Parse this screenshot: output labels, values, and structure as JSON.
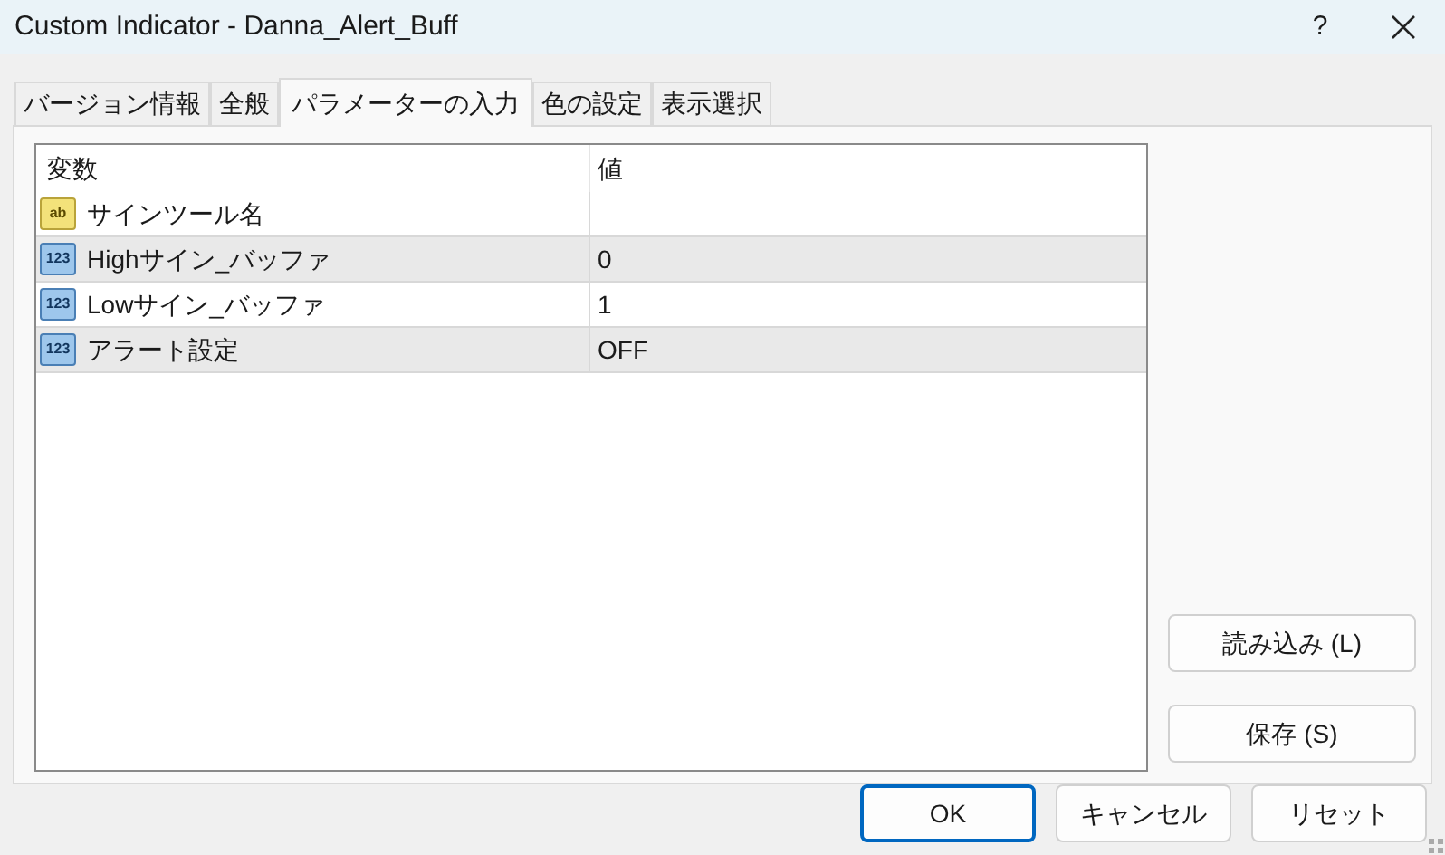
{
  "window": {
    "title": "Custom Indicator - Danna_Alert_Buff",
    "help": "?"
  },
  "tabs": [
    {
      "label": "バージョン情報",
      "selected": false
    },
    {
      "label": "全般",
      "selected": false
    },
    {
      "label": "パラメーターの入力",
      "selected": true
    },
    {
      "label": "色の設定",
      "selected": false
    },
    {
      "label": "表示選択",
      "selected": false
    }
  ],
  "table": {
    "columns": [
      "変数",
      "値"
    ],
    "rows": [
      {
        "kind": "text",
        "icon_text": "ab",
        "name": "サインツール名",
        "value": ""
      },
      {
        "kind": "number",
        "icon_text": "123",
        "name": "Highサイン_バッファ",
        "value": "0"
      },
      {
        "kind": "number",
        "icon_text": "123",
        "name": "Lowサイン_バッファ",
        "value": "1"
      },
      {
        "kind": "number",
        "icon_text": "123",
        "name": "アラート設定",
        "value": "OFF"
      }
    ]
  },
  "side_buttons": [
    "読み込み (L)",
    "保存 (S)"
  ],
  "buttons": [
    {
      "label": "OK",
      "default": true
    },
    {
      "label": "キャンセル",
      "default": false
    },
    {
      "label": "リセット",
      "default": false
    }
  ]
}
